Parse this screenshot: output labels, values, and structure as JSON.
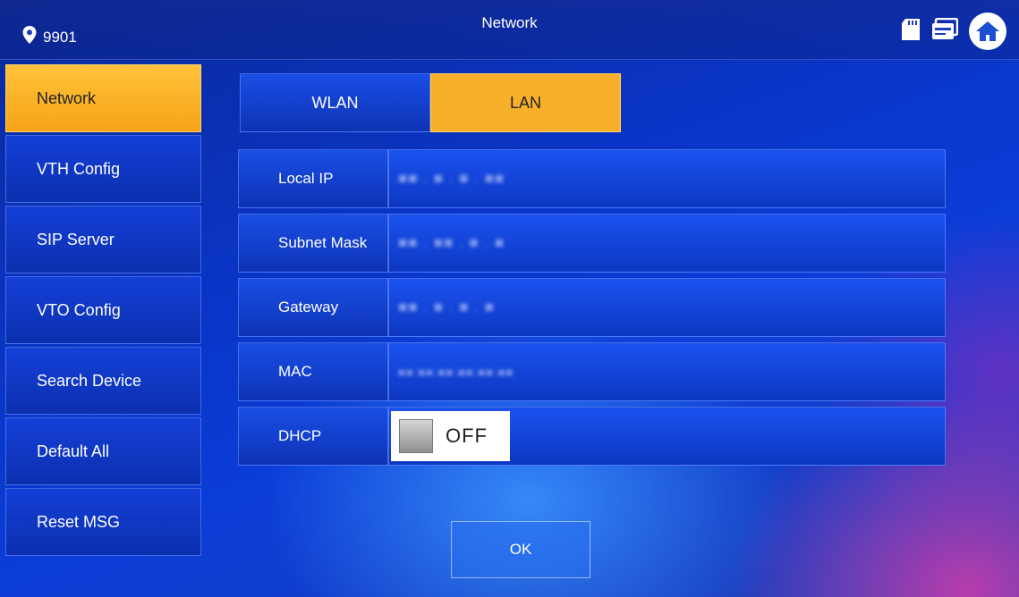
{
  "header": {
    "room_number": "9901",
    "title": "Network"
  },
  "sidebar": {
    "items": [
      {
        "label": "Network"
      },
      {
        "label": "VTH Config"
      },
      {
        "label": "SIP Server"
      },
      {
        "label": "VTO Config"
      },
      {
        "label": "Search Device"
      },
      {
        "label": "Default All"
      },
      {
        "label": "Reset MSG"
      }
    ],
    "active_index": 0
  },
  "tabs": [
    {
      "label": "WLAN"
    },
    {
      "label": "LAN"
    }
  ],
  "active_tab": "LAN",
  "form": {
    "local_ip": {
      "label": "Local IP",
      "value": "■■ . ■ . ■ . ■■"
    },
    "subnet_mask": {
      "label": "Subnet Mask",
      "value": "■■ . ■■ . ■ . ■"
    },
    "gateway": {
      "label": "Gateway",
      "value": "■■ . ■ . ■ . ■"
    },
    "mac": {
      "label": "MAC",
      "value": "■■:■■:■■:■■:■■:■■"
    },
    "dhcp": {
      "label": "DHCP",
      "state": "OFF"
    }
  },
  "ok_label": "OK",
  "colors": {
    "accent": "#f8b02a",
    "panel": "#0d33b4",
    "background": "#0b3dd8"
  },
  "icons": [
    "location-pin-icon",
    "sd-card-icon",
    "id-card-icon",
    "home-icon"
  ]
}
